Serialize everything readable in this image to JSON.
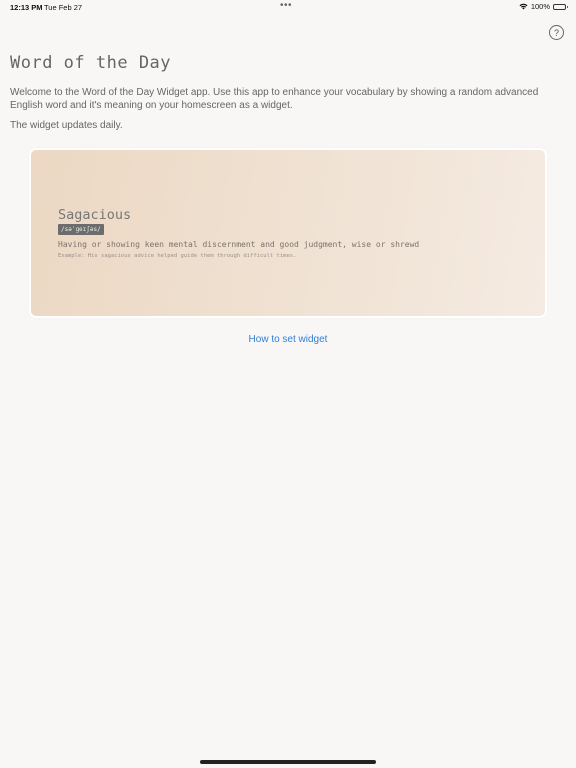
{
  "status_bar": {
    "time": "12:13 PM",
    "date": "Tue Feb 27",
    "dots": "•••",
    "battery": "100%"
  },
  "help": {
    "icon": "question-circle-icon",
    "glyph": "?"
  },
  "page": {
    "title": "Word of the Day",
    "intro": "Welcome to the Word of the Day Widget app. Use this app to enhance your vocabulary by showing a random advanced English word and it's meaning on your homescreen as a widget.",
    "update_note": "The widget updates daily."
  },
  "widget": {
    "word": "Sagacious",
    "phonetic": "/səˈɡeɪʃəs/",
    "definition": "Having or showing keen mental discernment and good judgment, wise or shrewd",
    "example": "Example: His sagacious advice helped guide them through difficult times."
  },
  "links": {
    "how_to": "How to set widget"
  },
  "colors": {
    "link": "#2f7fd8",
    "background": "#f9f7f5",
    "card_start": "#ecd8c3",
    "card_end": "#f5ebe2"
  }
}
